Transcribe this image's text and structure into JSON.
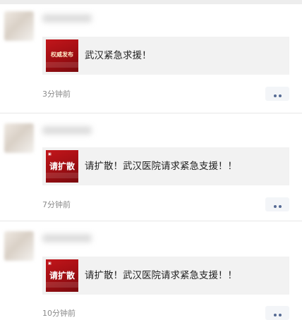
{
  "feed": {
    "posts": [
      {
        "thumb_text": "权威发布",
        "title": "武汉紧急求援！",
        "time": "3分钟前"
      },
      {
        "thumb_text": "请扩散",
        "title": "请扩散！武汉医院请求紧急支援！！",
        "time": "7分钟前"
      },
      {
        "thumb_text": "请扩散",
        "title": "请扩散！武汉医院请求紧急支援！！",
        "time": "10分钟前"
      }
    ]
  },
  "colors": {
    "thumb_red": "#b01318",
    "timestamp_gray": "#8a8a8a",
    "more_dots": "#566b94"
  },
  "icons": {
    "more": "more-dots-icon"
  }
}
